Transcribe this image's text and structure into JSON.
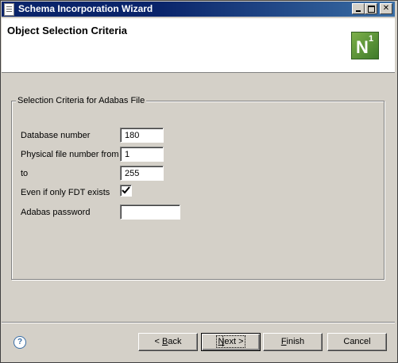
{
  "window": {
    "title": "Schema Incorporation Wizard"
  },
  "header": {
    "page_title": "Object Selection Criteria",
    "logo": {
      "letter": "N",
      "superscript": "1",
      "icon": "n1-logo"
    }
  },
  "group": {
    "legend": "Selection Criteria for Adabas File",
    "fields": [
      {
        "label": "Database number",
        "value": "180"
      },
      {
        "label": "Physical file number from",
        "value": "1"
      },
      {
        "label": "to",
        "value": "255"
      },
      {
        "label": "Even if only FDT exists",
        "checked": true
      },
      {
        "label": "Adabas password",
        "value": ""
      }
    ]
  },
  "footer": {
    "help_icon": "help-icon",
    "buttons": {
      "back": {
        "prefix": "< ",
        "mnemonic": "B",
        "rest": "ack"
      },
      "next": {
        "mnemonic": "N",
        "rest": "ext >"
      },
      "finish": {
        "mnemonic": "F",
        "rest": "inish"
      },
      "cancel": "Cancel"
    }
  }
}
